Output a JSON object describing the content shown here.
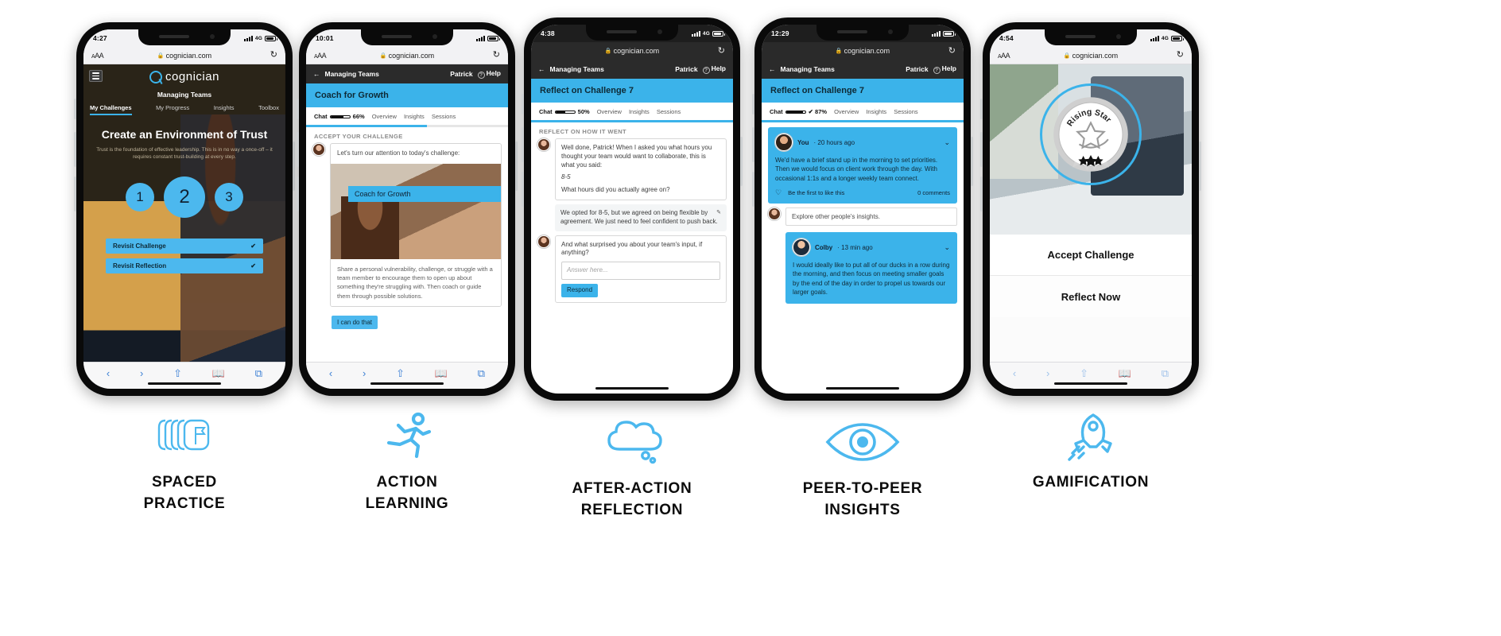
{
  "accent": "#3bb3ea",
  "columns": [
    {
      "id": "spaced-practice",
      "caption_line1": "SPACED",
      "caption_line2": "PRACTICE",
      "icon": "stacked-cards-flag-icon",
      "status": {
        "time": "4:27",
        "network": "4G"
      },
      "browser": {
        "aa": "AA",
        "url": "cognician.com",
        "reload": "↻"
      },
      "hero": {
        "brand": "cognician",
        "course": "Managing Teams",
        "tabs": [
          "My Challenges",
          "My Progress",
          "Insights",
          "Toolbox"
        ],
        "active_tab": "My Challenges",
        "title": "Create an Environment of Trust",
        "subtitle": "Trust is the foundation of effective leadership. This is in no way a once-off – it requires constant trust-building at every step.",
        "steps": [
          "1",
          "2",
          "3"
        ],
        "buttons": [
          {
            "label": "Revisit Challenge",
            "check": "✔"
          },
          {
            "label": "Revisit Reflection",
            "check": "✔"
          }
        ]
      }
    },
    {
      "id": "action-learning",
      "caption_line1": "ACTION",
      "caption_line2": "LEARNING",
      "icon": "running-person-icon",
      "status": {
        "time": "10:01",
        "network": ""
      },
      "browser": {
        "aa": "AA",
        "url": "cognician.com",
        "reload": "↻"
      },
      "appbar": {
        "back": "←",
        "course": "Managing Teams",
        "user": "Patrick",
        "help": "Help"
      },
      "title": "Coach for Growth",
      "tabs": {
        "chat": "Chat",
        "percent": "66%",
        "progress": 66,
        "others": [
          "Overview",
          "Insights",
          "Sessions"
        ]
      },
      "section_label": "ACCEPT YOUR CHALLENGE",
      "lead": "Let's turn our attention to today's challenge:",
      "card": {
        "tag": "Coach for Growth",
        "body": "Share a personal vulnerability, challenge, or struggle with a team member to encourage them to open up about something they're struggling with. Then coach or guide them through possible solutions."
      },
      "cta": "I can do that"
    },
    {
      "id": "after-action-reflection",
      "caption_line1": "AFTER-ACTION",
      "caption_line2": "REFLECTION",
      "icon": "thought-cloud-icon",
      "status": {
        "time": "4:38",
        "network": "4G"
      },
      "browser": {
        "aa": "",
        "url": "cognician.com",
        "reload": "↻"
      },
      "appbar": {
        "back": "←",
        "course": "Managing Teams",
        "user": "Patrick",
        "help": "Help"
      },
      "title": "Reflect on Challenge 7",
      "tabs": {
        "chat": "Chat",
        "percent": "50%",
        "progress": 50,
        "others": [
          "Overview",
          "Insights",
          "Sessions"
        ]
      },
      "section_label": "REFLECT ON HOW IT WENT",
      "messages": [
        {
          "type": "bot",
          "paras": [
            "Well done, Patrick! When I asked you what hours you thought your team would want to collaborate, this is what you said:",
            "8-5",
            "What hours did you actually agree on?"
          ]
        },
        {
          "type": "user",
          "paras": [
            "We opted for 8-5, but we agreed on being flexible by agreement. We just need to feel confident to push back."
          ],
          "edit_icon": "✎"
        },
        {
          "type": "bot",
          "paras": [
            "And what surprised you about your team's input, if anything?"
          ]
        }
      ],
      "answer_placeholder": "Answer here...",
      "respond_label": "Respond"
    },
    {
      "id": "peer-to-peer-insights",
      "caption_line1": "PEER-TO-PEER",
      "caption_line2": "INSIGHTS",
      "icon": "eye-icon",
      "status": {
        "time": "12:29",
        "network": ""
      },
      "browser": {
        "aa": "",
        "url": "cognician.com",
        "reload": "↻"
      },
      "appbar": {
        "back": "←",
        "course": "Managing Teams",
        "user": "Patrick",
        "help": "Help"
      },
      "title": "Reflect on Challenge 7",
      "tabs": {
        "chat": "Chat",
        "percent": "✔ 87%",
        "progress": 87,
        "others": [
          "Overview",
          "Insights",
          "Sessions"
        ]
      },
      "posts": [
        {
          "author": "You",
          "time": "20 hours ago",
          "text": "We'd have a brief stand up in the morning to set priorities. Then we would focus on client work through the day. With occasional 1:1s and a longer weekly team connect.",
          "like": "Be the first to like this",
          "comments": "0 comments",
          "chevron": "⌄"
        }
      ],
      "explore": "Explore other people's insights.",
      "post2": {
        "author": "Colby",
        "time": "13 min ago",
        "text": "I would ideally like to put all of our ducks in a row during the morning, and then focus on meeting smaller goals by the end of the day in order to propel us towards our larger goals.",
        "chevron": "⌄"
      }
    },
    {
      "id": "gamification",
      "caption_line1": "GAMIFICATION",
      "caption_line2": "",
      "icon": "rocket-icon",
      "status": {
        "time": "4:54",
        "network": "4G"
      },
      "browser": {
        "aa": "AA",
        "url": "cognician.com",
        "reload": "↻"
      },
      "badge": {
        "title": "Rising Star",
        "stars": "★★★"
      },
      "actions": [
        "Accept Challenge",
        "Reflect Now"
      ]
    }
  ],
  "toolbar_icons": [
    "back-icon",
    "forward-icon",
    "share-icon",
    "bookmarks-icon",
    "tabs-icon"
  ]
}
